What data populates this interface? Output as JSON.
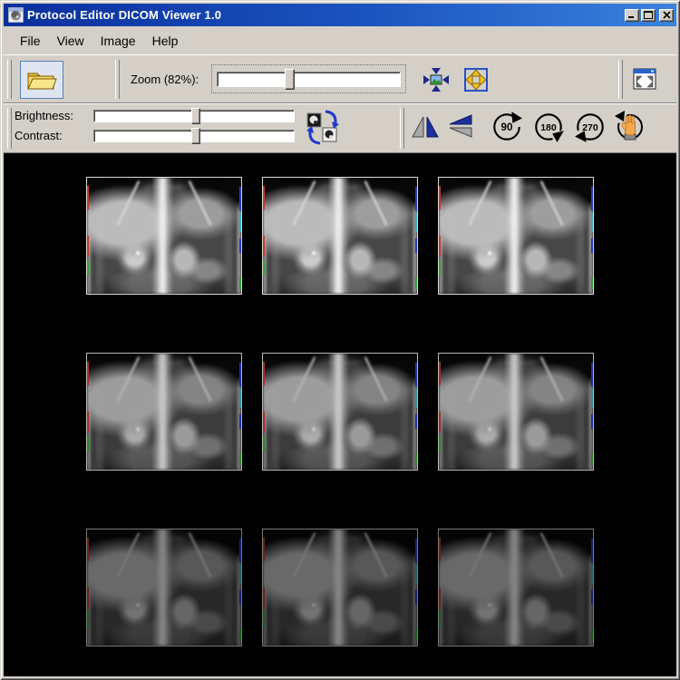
{
  "window": {
    "title": "Protocol Editor DICOM Viewer 1.0",
    "app_icon": "head-scan-icon",
    "buttons": {
      "minimize": "minimize",
      "maximize": "maximize",
      "close": "close"
    }
  },
  "menu": {
    "items": [
      {
        "label": "File"
      },
      {
        "label": "View"
      },
      {
        "label": "Image"
      },
      {
        "label": "Help"
      }
    ]
  },
  "toolbar": {
    "open_button": {
      "icon": "open-folder-icon"
    },
    "zoom": {
      "label": "Zoom (82%):",
      "percent": 82,
      "thumb_pct": 40
    },
    "fit_button": {
      "icon": "fit-image-to-window-icon"
    },
    "actual_size_button": {
      "icon": "image-actual-size-icon"
    },
    "fullscreen_button": {
      "icon": "expand-window-icon"
    }
  },
  "adjust": {
    "brightness": {
      "label": "Brightness:",
      "thumb_pct": 51
    },
    "contrast": {
      "label": "Contrast:",
      "thumb_pct": 51
    },
    "invert_button": {
      "icon": "invert-image-icon"
    },
    "flip_horizontal_button": {
      "icon": "flip-horizontal-icon"
    },
    "flip_vertical_button": {
      "icon": "flip-vertical-icon"
    },
    "rotate_buttons": [
      {
        "label": "90"
      },
      {
        "label": "180"
      },
      {
        "label": "270"
      }
    ],
    "free_rotate_button": {
      "icon": "rotate-hand-icon"
    }
  },
  "viewer": {
    "grid": {
      "rows": 3,
      "cols": 3
    },
    "row_brightness": [
      1,
      0.84,
      0.56
    ],
    "content": "coronal abdominal MR series thumbnails with RGB orientation edge markers"
  },
  "colors": {
    "titlebar_left": "#0b2f9c",
    "titlebar_right": "#3a82dc",
    "toolbar_bg": "#d4d0c8",
    "client_bg": "#000000",
    "folder_yellow": "#f5d866",
    "accent_blue": "#2850c8",
    "arrow_yellow": "#eec028",
    "flip_navy": "#1c2f9e",
    "hand_orange": "#f4a950",
    "marker_red": "#c23a28",
    "marker_green": "#2fa02f",
    "marker_blue": "#2238c8",
    "marker_teal": "#3aa8b8"
  }
}
